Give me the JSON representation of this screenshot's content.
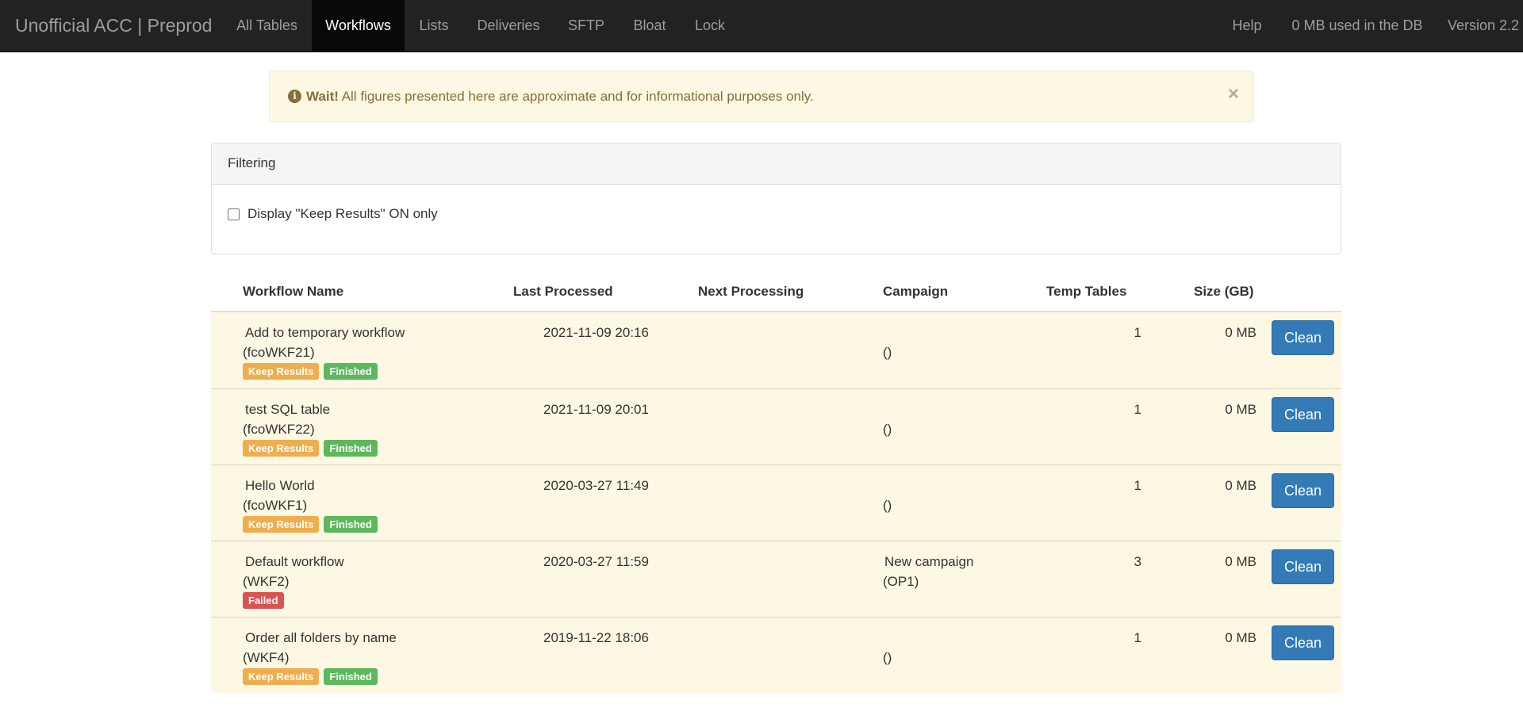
{
  "navbar": {
    "brand": "Unofficial ACC | Preprod",
    "items": [
      {
        "label": "All Tables",
        "active": false
      },
      {
        "label": "Workflows",
        "active": true
      },
      {
        "label": "Lists",
        "active": false
      },
      {
        "label": "Deliveries",
        "active": false
      },
      {
        "label": "SFTP",
        "active": false
      },
      {
        "label": "Bloat",
        "active": false
      },
      {
        "label": "Lock",
        "active": false
      }
    ],
    "right": {
      "help": "Help",
      "db_usage": "0 MB used in the DB",
      "version": "Version 2.2"
    }
  },
  "alert": {
    "icon": "info-circle-icon",
    "strong": "Wait!",
    "message": "All figures presented here are approximate and for informational purposes only.",
    "close": "×"
  },
  "filtering": {
    "heading": "Filtering",
    "checkbox_label": "Display \"Keep Results\" ON only",
    "checked": false
  },
  "table": {
    "headers": {
      "workflow_name": "Workflow Name",
      "last_processed": "Last Processed",
      "next_processing": "Next Processing",
      "campaign": "Campaign",
      "temp_tables": "Temp Tables",
      "size": "Size (GB)"
    },
    "clean_label": "Clean",
    "rows": [
      {
        "name": "Add to temporary workflow",
        "id": "(fcoWKF21)",
        "badges": [
          "Keep Results",
          "Finished"
        ],
        "last_processed": "2021-11-09 20:16",
        "next_processing": "",
        "campaign_name": "",
        "campaign_id": "()",
        "temp_tables": "1",
        "size": "0 MB"
      },
      {
        "name": "test SQL table",
        "id": "(fcoWKF22)",
        "badges": [
          "Keep Results",
          "Finished"
        ],
        "last_processed": "2021-11-09 20:01",
        "next_processing": "",
        "campaign_name": "",
        "campaign_id": "()",
        "temp_tables": "1",
        "size": "0 MB"
      },
      {
        "name": "Hello World",
        "id": "(fcoWKF1)",
        "badges": [
          "Keep Results",
          "Finished"
        ],
        "last_processed": "2020-03-27 11:49",
        "next_processing": "",
        "campaign_name": "",
        "campaign_id": "()",
        "temp_tables": "1",
        "size": "0 MB"
      },
      {
        "name": "Default workflow",
        "id": "(WKF2)",
        "badges": [
          "Failed"
        ],
        "last_processed": "2020-03-27 11:59",
        "next_processing": "",
        "campaign_name": "New campaign",
        "campaign_id": "(OP1)",
        "temp_tables": "3",
        "size": "0 MB"
      },
      {
        "name": "Order all folders by name",
        "id": "(WKF4)",
        "badges": [
          "Keep Results",
          "Finished"
        ],
        "last_processed": "2019-11-22 18:06",
        "next_processing": "",
        "campaign_name": "",
        "campaign_id": "()",
        "temp_tables": "1",
        "size": "0 MB"
      }
    ]
  },
  "colors": {
    "navbar_bg": "#222222",
    "active_nav_bg": "#080808",
    "alert_bg": "#fcf8e3",
    "row_bg": "#fcf8e3",
    "badge_keep_results": "#f0ad4e",
    "badge_finished": "#5cb85c",
    "badge_failed": "#d9534f",
    "clean_button": "#337ab7"
  }
}
